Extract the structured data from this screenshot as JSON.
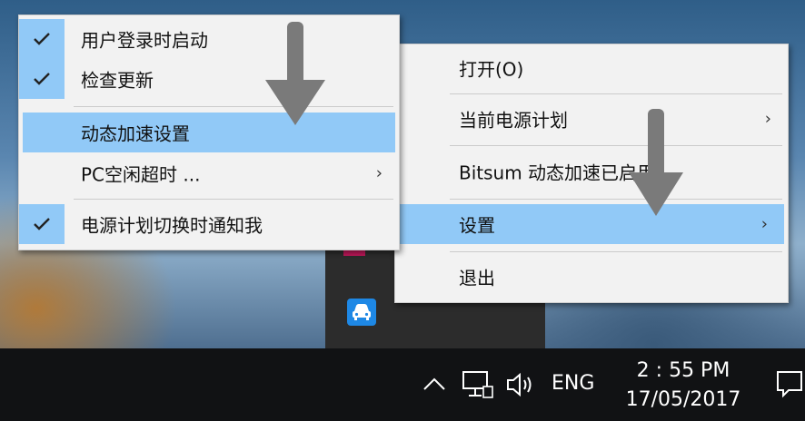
{
  "left_menu": {
    "items": [
      {
        "label": "用户登录时启动",
        "checked": true
      },
      {
        "label": "检查更新",
        "checked": true
      },
      {
        "label": "动态加速设置",
        "checked": false,
        "highlighted": true
      },
      {
        "label": "PC空闲超时 ...",
        "checked": false,
        "has_submenu": true
      },
      {
        "label": "电源计划切换时通知我",
        "checked": true
      }
    ]
  },
  "right_menu": {
    "items": [
      {
        "label": "打开(O)"
      },
      {
        "label": "当前电源计划",
        "has_submenu": true
      },
      {
        "label": "Bitsum 动态加速已启用"
      },
      {
        "label": "设置",
        "has_submenu": true,
        "highlighted": true
      },
      {
        "label": "退出"
      }
    ]
  },
  "taskbar": {
    "language": "ENG",
    "time": "2 : 55 PM",
    "date": "17/05/2017",
    "icons": [
      "chevron-up-icon",
      "network-icon",
      "volume-icon",
      "notification-icon"
    ]
  },
  "colors": {
    "highlight": "#91c9f7",
    "menu_bg": "#f2f2f2",
    "taskbar_bg": "#111214",
    "annotation_arrow": "#7a7a7a"
  }
}
